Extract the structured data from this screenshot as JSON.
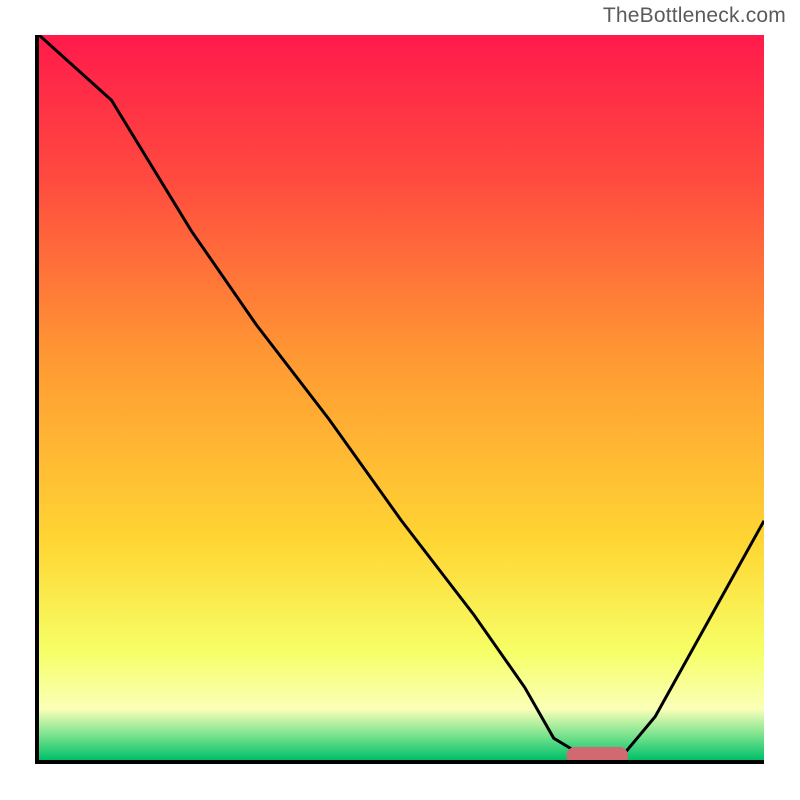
{
  "watermark": "TheBottleneck.com",
  "chart_data": {
    "type": "line",
    "title": "",
    "xlabel": "",
    "ylabel": "",
    "xlim": [
      0,
      100
    ],
    "ylim": [
      0,
      100
    ],
    "grid": false,
    "legend": false,
    "gradient_stops": [
      {
        "offset": 0.0,
        "color": "#ff1a4b"
      },
      {
        "offset": 0.2,
        "color": "#ff4b3f"
      },
      {
        "offset": 0.45,
        "color": "#ff9a33"
      },
      {
        "offset": 0.7,
        "color": "#ffd633"
      },
      {
        "offset": 0.85,
        "color": "#f6ff66"
      },
      {
        "offset": 0.93,
        "color": "#faffb8"
      },
      {
        "offset": 0.965,
        "color": "#7de38f"
      },
      {
        "offset": 1.0,
        "color": "#00c06a"
      }
    ],
    "series": [
      {
        "name": "bottleneck-curve",
        "color": "#000000",
        "x": [
          0,
          10,
          21,
          30,
          40,
          50,
          60,
          67,
          71,
          76,
          80,
          85,
          90,
          95,
          100
        ],
        "y": [
          100,
          91,
          73,
          60,
          47,
          33,
          20,
          10,
          3,
          0,
          0,
          6,
          15,
          24,
          33
        ]
      }
    ],
    "marker": {
      "name": "optimal-pill",
      "shape": "rounded-rect",
      "color": "#d06a70",
      "cx": 77,
      "cy": 0.6,
      "width": 8.5,
      "height": 2.4
    }
  }
}
